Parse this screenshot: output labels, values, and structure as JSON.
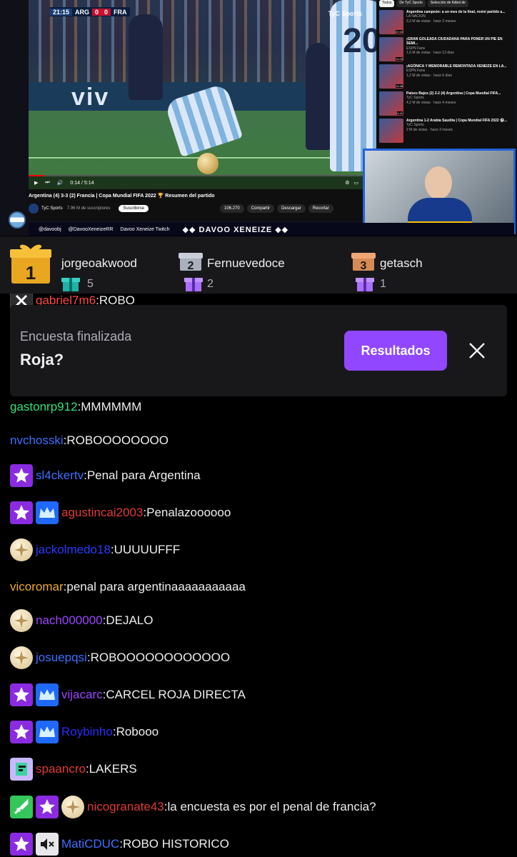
{
  "stream": {
    "scorebug": {
      "time": "21:15",
      "home": "ARG",
      "home_score": "0",
      "away_score": "0",
      "away": "FRA"
    },
    "broadcaster": "TyC Sports",
    "ad_text": "viv",
    "jersey_number": "20",
    "video_title": "Argentina (4) 3-3 (2) Francia | Copa Mundial FIFA 2022 🏆 Resumen del partido",
    "channel": {
      "name": "TyC Sports",
      "subscribers": "7.96 M de suscriptores",
      "subscribe_label": "Suscribirse"
    },
    "actions": {
      "likes": "106.270",
      "share": "Compartir",
      "download": "Descargar",
      "clip": "Recortar"
    },
    "playback_time": "0:14 / 5:14",
    "playback_progress": 0.045,
    "rec_tabs": [
      "Todos",
      "De TyC Sports",
      "Selección de fútbol de"
    ],
    "recommendations": [
      {
        "title": "Argentina campeón: a un mes de la final, reviví partido a...",
        "channel": "LA NACION",
        "meta": "3,3 M de vistas · hace 3 meses",
        "duration": "22:43"
      },
      {
        "title": "¡GRAN GOLEADA CIUDADANA PARA PONER UN PIE EN SEMI...",
        "channel": "ESPN Fans",
        "meta": "1,6 M de vistas · hace 13 días",
        "duration": "11:03"
      },
      {
        "title": "¡AGÓNICA Y MEMORABLE REMONTADA XENEIZE EN LA...",
        "channel": "ESPN Fans",
        "meta": "1,2 M de vistas · hace 6 días",
        "duration": "12:38"
      },
      {
        "title": "Países Bajos (2) 2-2 (4) Argentina | Copa Mundial FIFA...",
        "channel": "TyC Sports",
        "meta": "4,2 M de vistas · hace 4 meses",
        "duration": "4:41"
      },
      {
        "title": "Argentina 1-2 Arabia Saudita | Copa Mundial FIFA 2022 ⚽...",
        "channel": "TyC Sports",
        "meta": "2 M de vistas · hace 3 meses",
        "duration": ""
      }
    ],
    "overlay": {
      "instagram": "@davoobj",
      "twitter": "@DavooXeneizeRR",
      "youtube": "Davoo Xeneize Twitch",
      "brand": "◆◆ DAVOO XENEIZE ◆◆"
    }
  },
  "leaderboard": [
    {
      "rank": "1",
      "name": "jorgeoakwood",
      "count": "5"
    },
    {
      "rank": "2",
      "name": "Fernuevedoce",
      "count": "2"
    },
    {
      "rank": "3",
      "name": "getasch",
      "count": "1"
    }
  ],
  "chat": {
    "cut_message": {
      "user": "gabriel7m6",
      "text": "ROBO",
      "color": "#ff4a4a"
    },
    "poll": {
      "label": "Encuesta finalizada",
      "question": "Roja?",
      "results_label": "Resultados"
    },
    "messages": [
      {
        "user": "gastonrp912",
        "text": "MMMMMM",
        "color": "#33e07a",
        "badges": []
      },
      {
        "user": "nvchosski",
        "text": "ROBOOOOOOOO",
        "color": "#3d6fff",
        "badges": []
      },
      {
        "user": "sl4ckertv",
        "text": "Penal para Argentina",
        "color": "#3d6fff",
        "badges": [
          "star-badge-icon"
        ]
      },
      {
        "user": "agustincai2003",
        "text": "Penalazoooooo",
        "color": "#e03a3a",
        "badges": [
          "star-badge-icon",
          "crown-badge-icon"
        ]
      },
      {
        "user": "jackolmedo18",
        "text": "UUUUUFFF",
        "color": "#2a3cff",
        "badges": [
          "compass-badge-icon"
        ]
      },
      {
        "user": "vicoromar",
        "text": "penal para argentinaaaaaaaaaaa",
        "color": "#f0a830",
        "badges": []
      },
      {
        "user": "nach000000",
        "text": "DEJALO",
        "color": "#9a45ff",
        "badges": [
          "compass-badge-icon"
        ]
      },
      {
        "user": "josuepqsi",
        "text": "ROBOOOOOOOOOOOO",
        "color": "#3d6fff",
        "badges": [
          "compass-badge-icon"
        ]
      },
      {
        "user": "vijacarc",
        "text": "CARCEL ROJA DIRECTA",
        "color": "#9a45ff",
        "badges": [
          "star-badge-icon",
          "crown-badge-icon"
        ]
      },
      {
        "user": "Roybinho",
        "text": "Robooo",
        "color": "#2a2aff",
        "badges": [
          "star-badge-icon",
          "crown-badge-icon"
        ]
      },
      {
        "user": "spaancro",
        "text": "LAKERS",
        "color": "#e03a3a",
        "badges": [
          "pixel-badge-icon"
        ]
      },
      {
        "user": "nicogranate43",
        "text": "la encuesta es por el penal de francia?",
        "color": "#e03a3a",
        "badges": [
          "sword-badge-icon",
          "star-badge-icon",
          "compass-badge-icon"
        ]
      },
      {
        "user": "MatiCDUC",
        "text": "ROBO HISTORICO",
        "color": "#3d6fff",
        "badges": [
          "star-badge-icon",
          "mute-badge-icon"
        ]
      }
    ]
  }
}
